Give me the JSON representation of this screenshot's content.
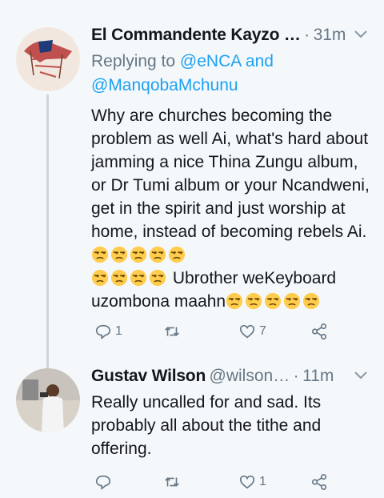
{
  "tweets": [
    {
      "author_name": "El Commandente Kayzo …",
      "separator": "·",
      "time": "31m",
      "replying_prefix": "Replying to ",
      "reply_handle_1": "@eNCA",
      "reply_and": " and",
      "reply_handle_2": "@ManqobaMchunu",
      "text_1": "Why are churches becoming the problem as well Ai, what's hard about jamming a nice Thina Zungu album, or Dr Tumi album or your Ncandweni, get in the spirit and just worship at home, instead of becoming rebels Ai. ",
      "text_2": " Ubrother weKeyboard uzombona maahn",
      "emoji_name": "unamused-face-emoji",
      "reply_count": "1",
      "retweet_count": "",
      "like_count": "7"
    },
    {
      "author_name": "Gustav Wilson",
      "handle": "@wilson…",
      "separator": "·",
      "time": "11m",
      "text": "Really uncalled for and sad. Its probably all about the tithe and offering.",
      "reply_count": "",
      "retweet_count": "",
      "like_count": "1"
    }
  ],
  "colors": {
    "link": "#1da1f2",
    "muted": "#657786",
    "background": "#f5f8fa",
    "text": "#14171a"
  },
  "icons": [
    "reply-icon",
    "retweet-icon",
    "like-icon",
    "share-icon",
    "caret-down-icon"
  ]
}
